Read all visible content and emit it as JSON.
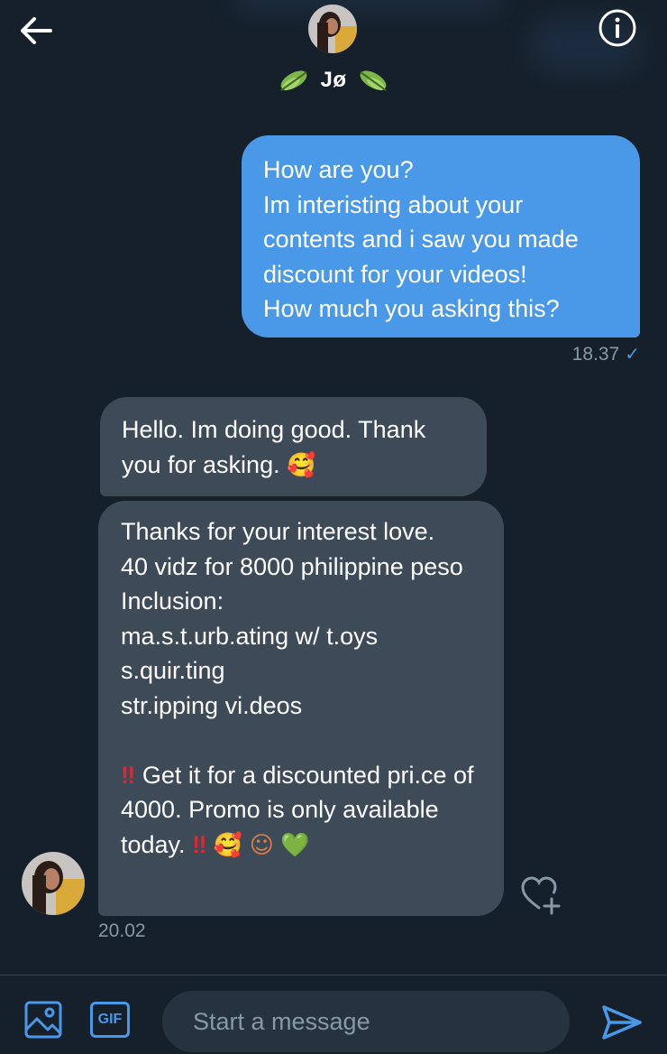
{
  "header": {
    "name": "Jø",
    "back_icon": "arrow-left-icon",
    "info_icon": "info-icon",
    "leaf_icon": "leaf-emoji"
  },
  "messages": {
    "sent": {
      "text": "How are you?\nIm interisting about your contents and i saw you made discount for your videos!\nHow much you asking this?",
      "time": "18.37"
    },
    "received_1": {
      "text": "Hello. Im doing good. Thank you for asking.",
      "emoji": "🥰"
    },
    "received_2": {
      "lines": "Thanks for your interest love.\n40 vidz for 8000 philippine peso\nInclusion:\nma.s.t.urb.ating w/ t.oys\ns.quir.ting\nstr.ipping vi.deos",
      "promo_bang": "‼",
      "promo_text": " Get it for a discounted pri.ce of 4000. Promo is only available today. ",
      "promo_bang_2": "‼",
      "emoji_1": "🥰",
      "emoji_2": "☺",
      "emoji_3": "💚",
      "time": "20.02"
    }
  },
  "composer": {
    "placeholder": "Start a message",
    "gif_label": "GIF"
  },
  "colors": {
    "background": "#15202b",
    "sent_bubble": "#4a99e9",
    "received_bubble": "#3d4a58",
    "muted_text": "#8899a6",
    "accent": "#4a99e9"
  }
}
